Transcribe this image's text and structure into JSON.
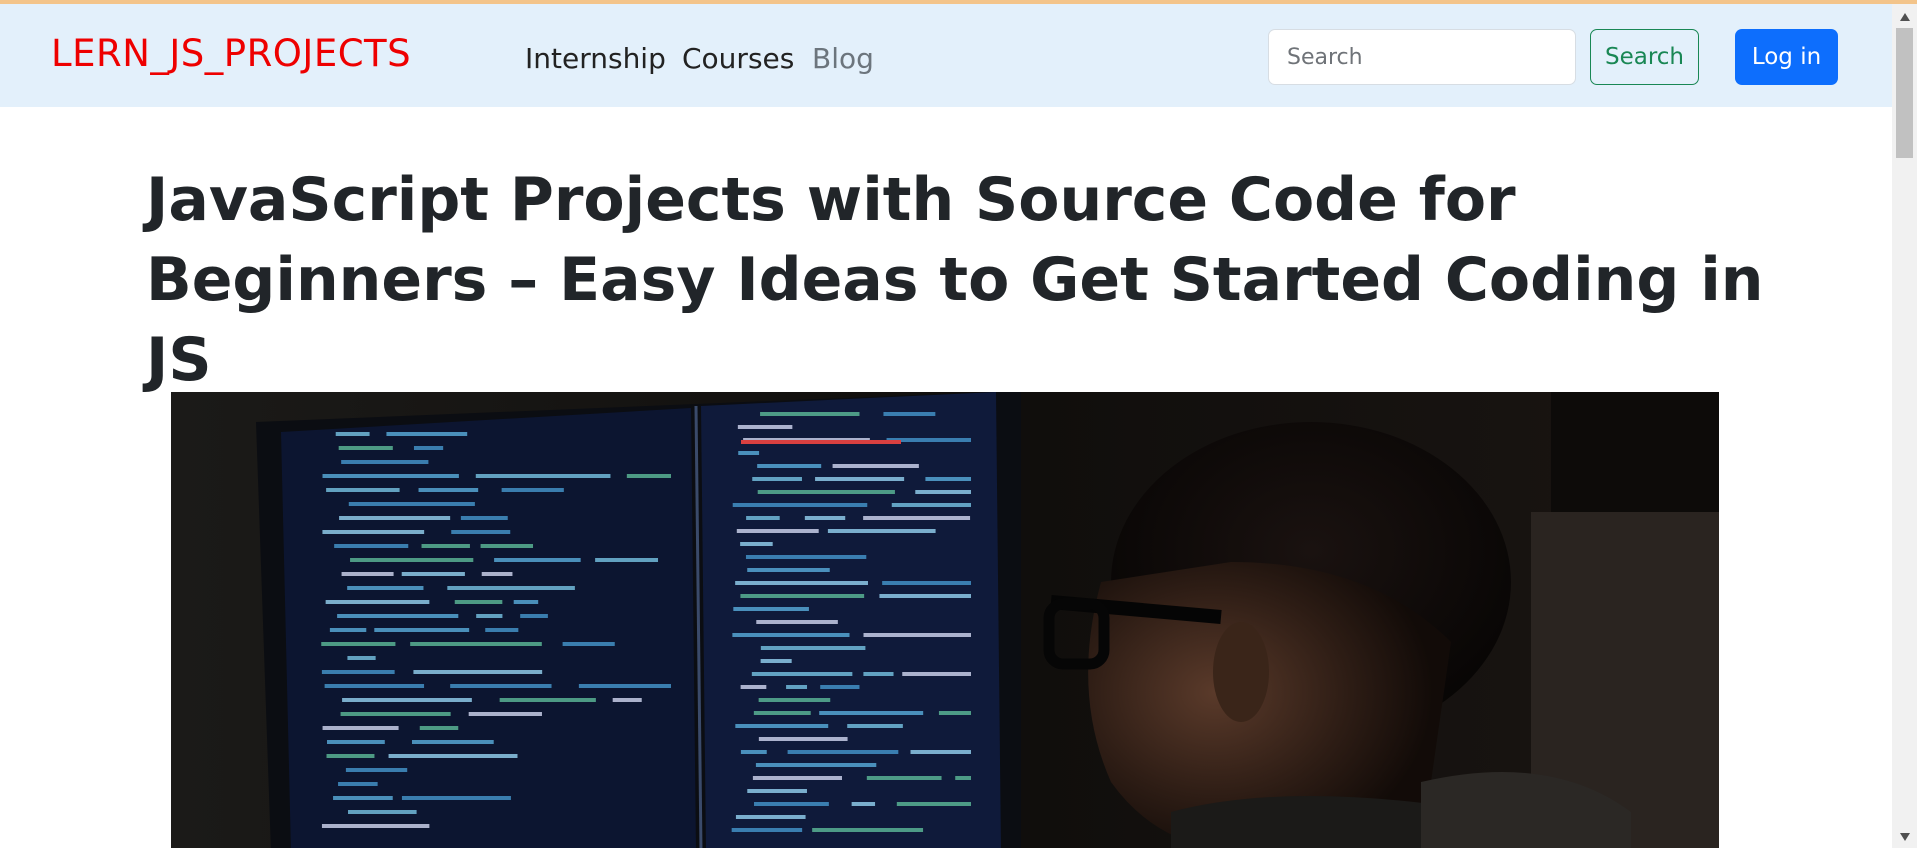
{
  "header": {
    "brand": "LERN_JS_PROJECTS",
    "nav_links": [
      "Internship",
      "Courses",
      "Blog"
    ],
    "search": {
      "placeholder": "Search",
      "button_label": "Search"
    },
    "login_label": "Log in"
  },
  "main": {
    "title": "JavaScript Projects with Source Code for Beginners – Easy Ideas to Get Started Coding in JS"
  },
  "colors": {
    "brand": "#ee0000",
    "navbar_bg": "#e3f0fb",
    "search_button": "#198754",
    "login_button": "#0d6efd"
  },
  "icons": {
    "scroll_up": "triangle-up-icon",
    "scroll_down": "triangle-down-icon"
  }
}
